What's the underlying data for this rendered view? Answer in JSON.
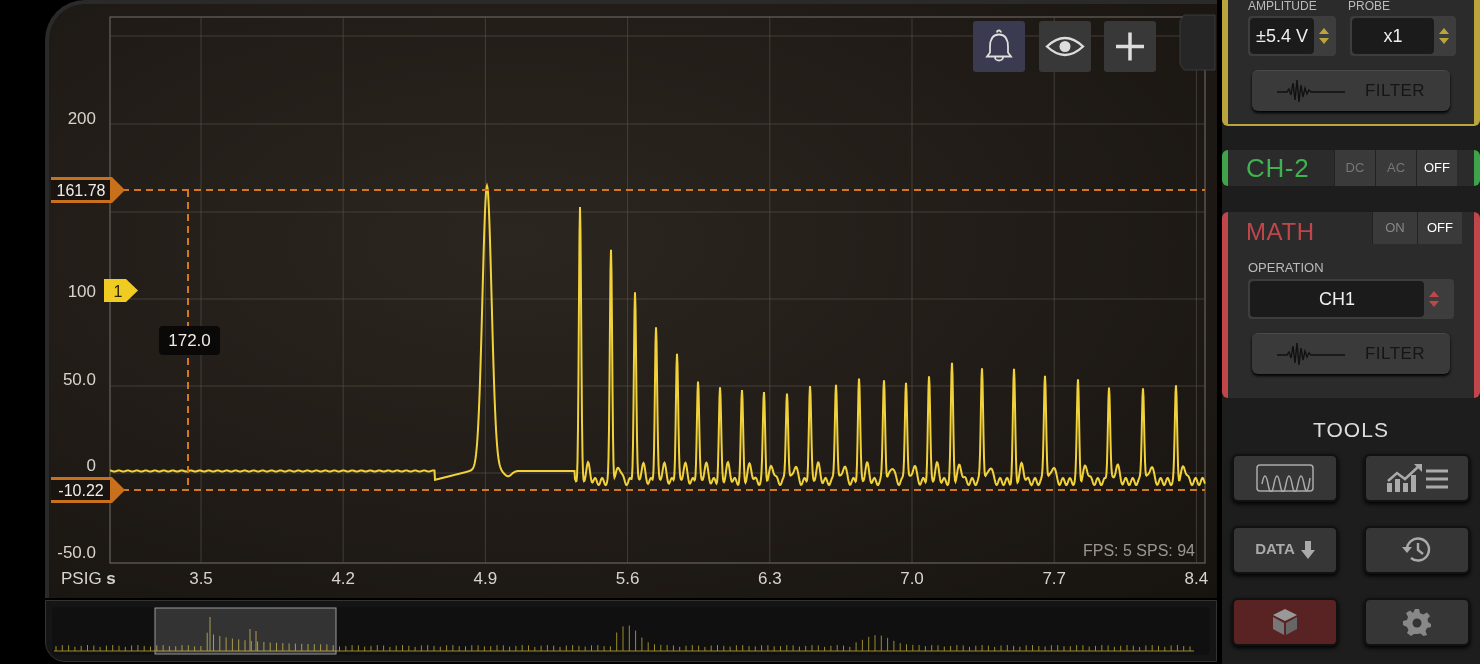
{
  "scope": {
    "y_ticks": [
      "200",
      "100",
      "50.0",
      "0",
      "-50.0"
    ],
    "x_ticks": [
      "3.5",
      "4.2",
      "4.9",
      "5.6",
      "6.3",
      "7.0",
      "7.7",
      "8.4"
    ],
    "x_unit_label": "PSIG **s**",
    "upper_cursor": "161.78",
    "lower_cursor": "-10.22",
    "time_readout": "172.0",
    "trigger_marker": "1",
    "stats": "FPS: 5  SPS: 94"
  },
  "toolbar": [
    {
      "kind": "bell",
      "selected": true
    },
    {
      "kind": "eye",
      "selected": false
    },
    {
      "kind": "plus",
      "selected": false
    }
  ],
  "ch1_panel": {
    "amplitude_label": "AMPLITUDE",
    "amplitude": "±5.4 V",
    "probe_label": "PROBE",
    "probe": "x1",
    "filter": "FILTER"
  },
  "ch2": {
    "title": "CH-2",
    "modes": [
      {
        "label": "DC",
        "selected": false
      },
      {
        "label": "AC",
        "selected": false
      },
      {
        "label": "OFF",
        "selected": true
      }
    ]
  },
  "math": {
    "title": "MATH",
    "modes": [
      {
        "label": "ON",
        "selected": false
      },
      {
        "label": "OFF",
        "selected": true
      }
    ],
    "operation_label": "OPERATION",
    "operation": "CH1",
    "filter": "FILTER"
  },
  "tools": {
    "title": "TOOLS",
    "buttons": [
      {
        "kind": "waveform",
        "selected": false
      },
      {
        "kind": "chart-list",
        "selected": false
      },
      {
        "kind": "data",
        "label": "DATA",
        "selected": false
      },
      {
        "kind": "history",
        "selected": false
      },
      {
        "kind": "cube",
        "selected": true
      },
      {
        "kind": "settings",
        "selected": false
      }
    ]
  }
}
